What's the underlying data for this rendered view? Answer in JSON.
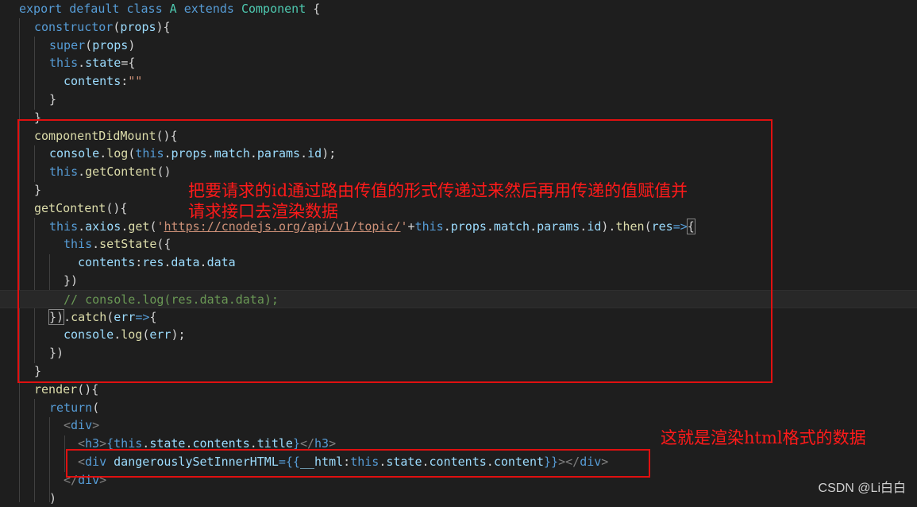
{
  "code": {
    "line01": [
      "export",
      "default",
      "class",
      "A",
      "extends",
      "Component",
      "{"
    ],
    "line02": [
      "constructor",
      "(",
      "props",
      "){"
    ],
    "line03": [
      "super",
      "(",
      "props",
      ")"
    ],
    "line04": [
      "this",
      ".",
      "state",
      "={"
    ],
    "line05": [
      "contents",
      ":",
      "\"\""
    ],
    "line06": "}",
    "line07": "}",
    "line08": [
      "componentDidMount",
      "(){"
    ],
    "line09": [
      "console",
      ".",
      "log",
      "(",
      "this",
      ".",
      "props",
      ".",
      "match",
      ".",
      "params",
      ".",
      "id",
      ");"
    ],
    "line10": [
      "this",
      ".",
      "getContent",
      "()"
    ],
    "line11": "}",
    "line12": [
      "getContent",
      "(){"
    ],
    "line13": [
      "this",
      ".",
      "axios",
      ".",
      "get",
      "(",
      "'",
      "https://cnodejs.org/api/v1/topic/",
      "'",
      "+",
      "this",
      ".",
      "props",
      ".",
      "match",
      ".",
      "params",
      ".",
      "id",
      ").",
      "then",
      "(",
      "res",
      "=>",
      "{"
    ],
    "line14": [
      "this",
      ".",
      "setState",
      "({"
    ],
    "line15": [
      "contents",
      ":",
      "res",
      ".",
      "data",
      ".",
      "data"
    ],
    "line16": "})",
    "line17": "// console.log(res.data.data);",
    "line18": [
      "})",
      ".",
      "catch",
      "(",
      "err",
      "=>",
      "{"
    ],
    "line19": [
      "console",
      ".",
      "log",
      "(",
      "err",
      ");"
    ],
    "line20": "})",
    "line21": "}",
    "line22": [
      "render",
      "(){"
    ],
    "line23": [
      "return",
      "("
    ],
    "line24": [
      "<",
      "div",
      ">"
    ],
    "line25": [
      "<",
      "h3",
      ">",
      "{",
      "this",
      ".",
      "state",
      ".",
      "contents",
      ".",
      "title",
      "}",
      "</",
      "h3",
      ">"
    ],
    "line26": [
      "<",
      "div",
      "dangerouslySetInnerHTML",
      "={{",
      "__html",
      ":",
      "this",
      ".",
      "state",
      ".",
      "contents",
      ".",
      "content",
      "}}",
      "></",
      "div",
      ">"
    ],
    "line27": [
      "</",
      "div",
      ">"
    ],
    "line28": ")"
  },
  "annotations": {
    "note1_line1": "把要请求的id通过路由传值的形式传递过来然后再用传递的值赋值并",
    "note1_line2": "请求接口去渲染数据",
    "note2": "这就是渲染html格式的数据"
  },
  "watermark": "CSDN @Li白白",
  "colors": {
    "background": "#1e1e1e",
    "keyword": "#569cd6",
    "class": "#4ec9b0",
    "function": "#dcdcaa",
    "variable": "#9cdcfe",
    "string": "#ce9178",
    "comment": "#6a9955",
    "annotation": "#ff1a1a"
  }
}
